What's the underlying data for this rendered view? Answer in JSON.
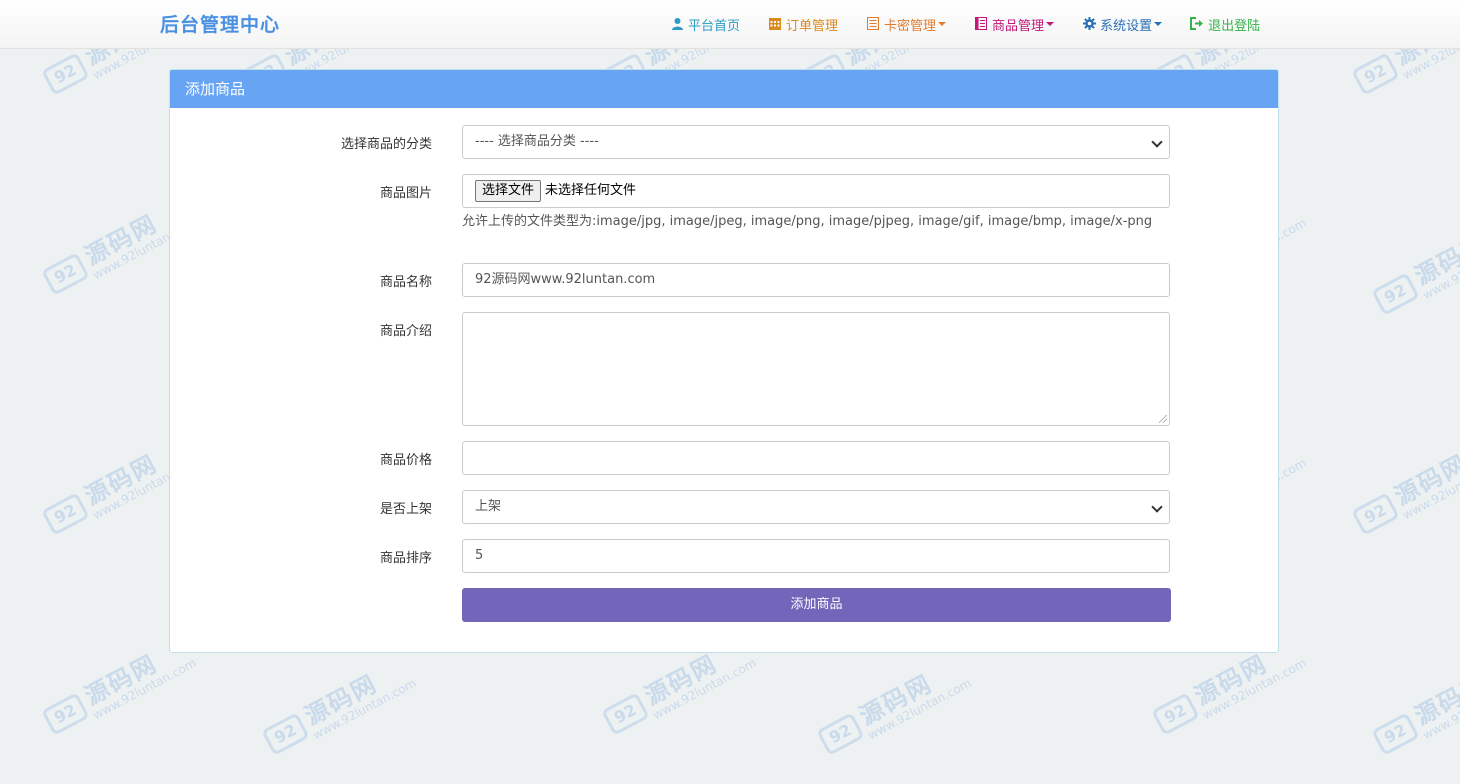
{
  "brand": "后台管理中心",
  "nav": [
    {
      "label": "平台首页",
      "icon": "user-icon",
      "color": "#2b9bc4",
      "dropdown": false
    },
    {
      "label": "订单管理",
      "icon": "calendar-icon",
      "color": "#d98a1d",
      "dropdown": false
    },
    {
      "label": "卡密管理",
      "icon": "list-icon",
      "color": "#e07b2f",
      "dropdown": true
    },
    {
      "label": "商品管理",
      "icon": "book-icon",
      "color": "#c2187a",
      "dropdown": true
    },
    {
      "label": "系统设置",
      "icon": "gear-icon",
      "color": "#2a6fb5",
      "dropdown": true
    },
    {
      "label": "退出登陆",
      "icon": "logout-icon",
      "color": "#35b24a",
      "dropdown": false
    }
  ],
  "panel": {
    "title": "添加商品",
    "header_color": "#67a4f4"
  },
  "form": {
    "category": {
      "label": "选择商品的分类",
      "value": "---- 选择商品分类 ----"
    },
    "image": {
      "label": "商品图片",
      "button": "选择文件",
      "status": "未选择任何文件",
      "help": "允许上传的文件类型为:image/jpg, image/jpeg, image/png, image/pjpeg, image/gif, image/bmp, image/x-png"
    },
    "name": {
      "label": "商品名称",
      "value": "92源码网www.92luntan.com"
    },
    "intro": {
      "label": "商品介绍",
      "value": ""
    },
    "price": {
      "label": "商品价格",
      "value": ""
    },
    "listed": {
      "label": "是否上架",
      "value": "上架"
    },
    "sort": {
      "label": "商品排序",
      "value": "5"
    },
    "submit": "添加商品",
    "submit_color": "#7265ba"
  },
  "watermark": {
    "logo": "92",
    "text": "源码网",
    "url": "www.92luntan.com"
  }
}
